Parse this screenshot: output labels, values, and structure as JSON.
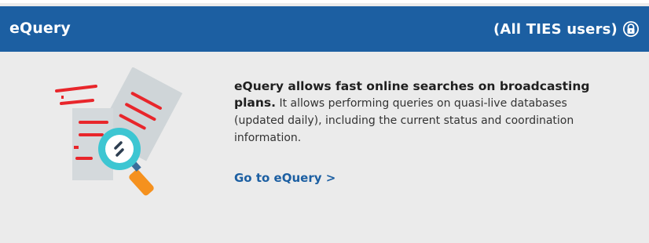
{
  "header": {
    "title": "eQuery",
    "access_label": "(All TIES users)",
    "lock_icon": "lock-icon"
  },
  "content": {
    "description_lead": "eQuery allows fast online searches on broadcasting plans.",
    "description_rest": " It allows performing queries on quasi-live databases (updated daily), including the current status and coordination information.",
    "cta_label": "Go to eQuery >"
  },
  "illustration": {
    "icon": "document-search-icon"
  },
  "colors": {
    "header_bg": "#1c5fa2",
    "panel_bg": "#ebebeb",
    "link": "#1c5fa2",
    "accent_red": "#e8262b",
    "accent_teal": "#3dc6d2",
    "accent_orange": "#f5911e"
  }
}
